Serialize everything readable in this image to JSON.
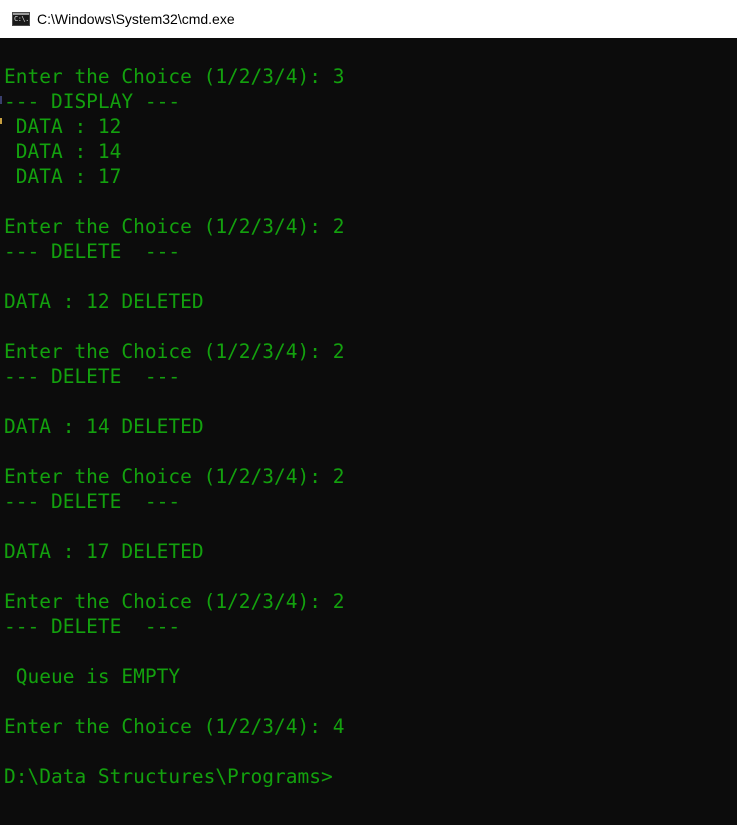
{
  "window": {
    "title": "C:\\Windows\\System32\\cmd.exe",
    "icon_name": "cmd-icon",
    "icon_glyph": "C:\\."
  },
  "colors": {
    "console_background": "#0c0c0c",
    "console_text": "#13a10e",
    "titlebar_background": "#ffffff"
  },
  "console": {
    "lines": [
      "Enter the Choice (1/2/3/4): 3",
      "--- DISPLAY ---",
      " DATA : 12",
      " DATA : 14",
      " DATA : 17",
      "",
      "Enter the Choice (1/2/3/4): 2",
      "--- DELETE  ---",
      "",
      "DATA : 12 DELETED",
      "",
      "Enter the Choice (1/2/3/4): 2",
      "--- DELETE  ---",
      "",
      "DATA : 14 DELETED",
      "",
      "Enter the Choice (1/2/3/4): 2",
      "--- DELETE  ---",
      "",
      "DATA : 17 DELETED",
      "",
      "Enter the Choice (1/2/3/4): 2",
      "--- DELETE  ---",
      "",
      " Queue is EMPTY",
      "",
      "Enter the Choice (1/2/3/4): 4",
      "",
      "D:\\Data Structures\\Programs>"
    ]
  }
}
